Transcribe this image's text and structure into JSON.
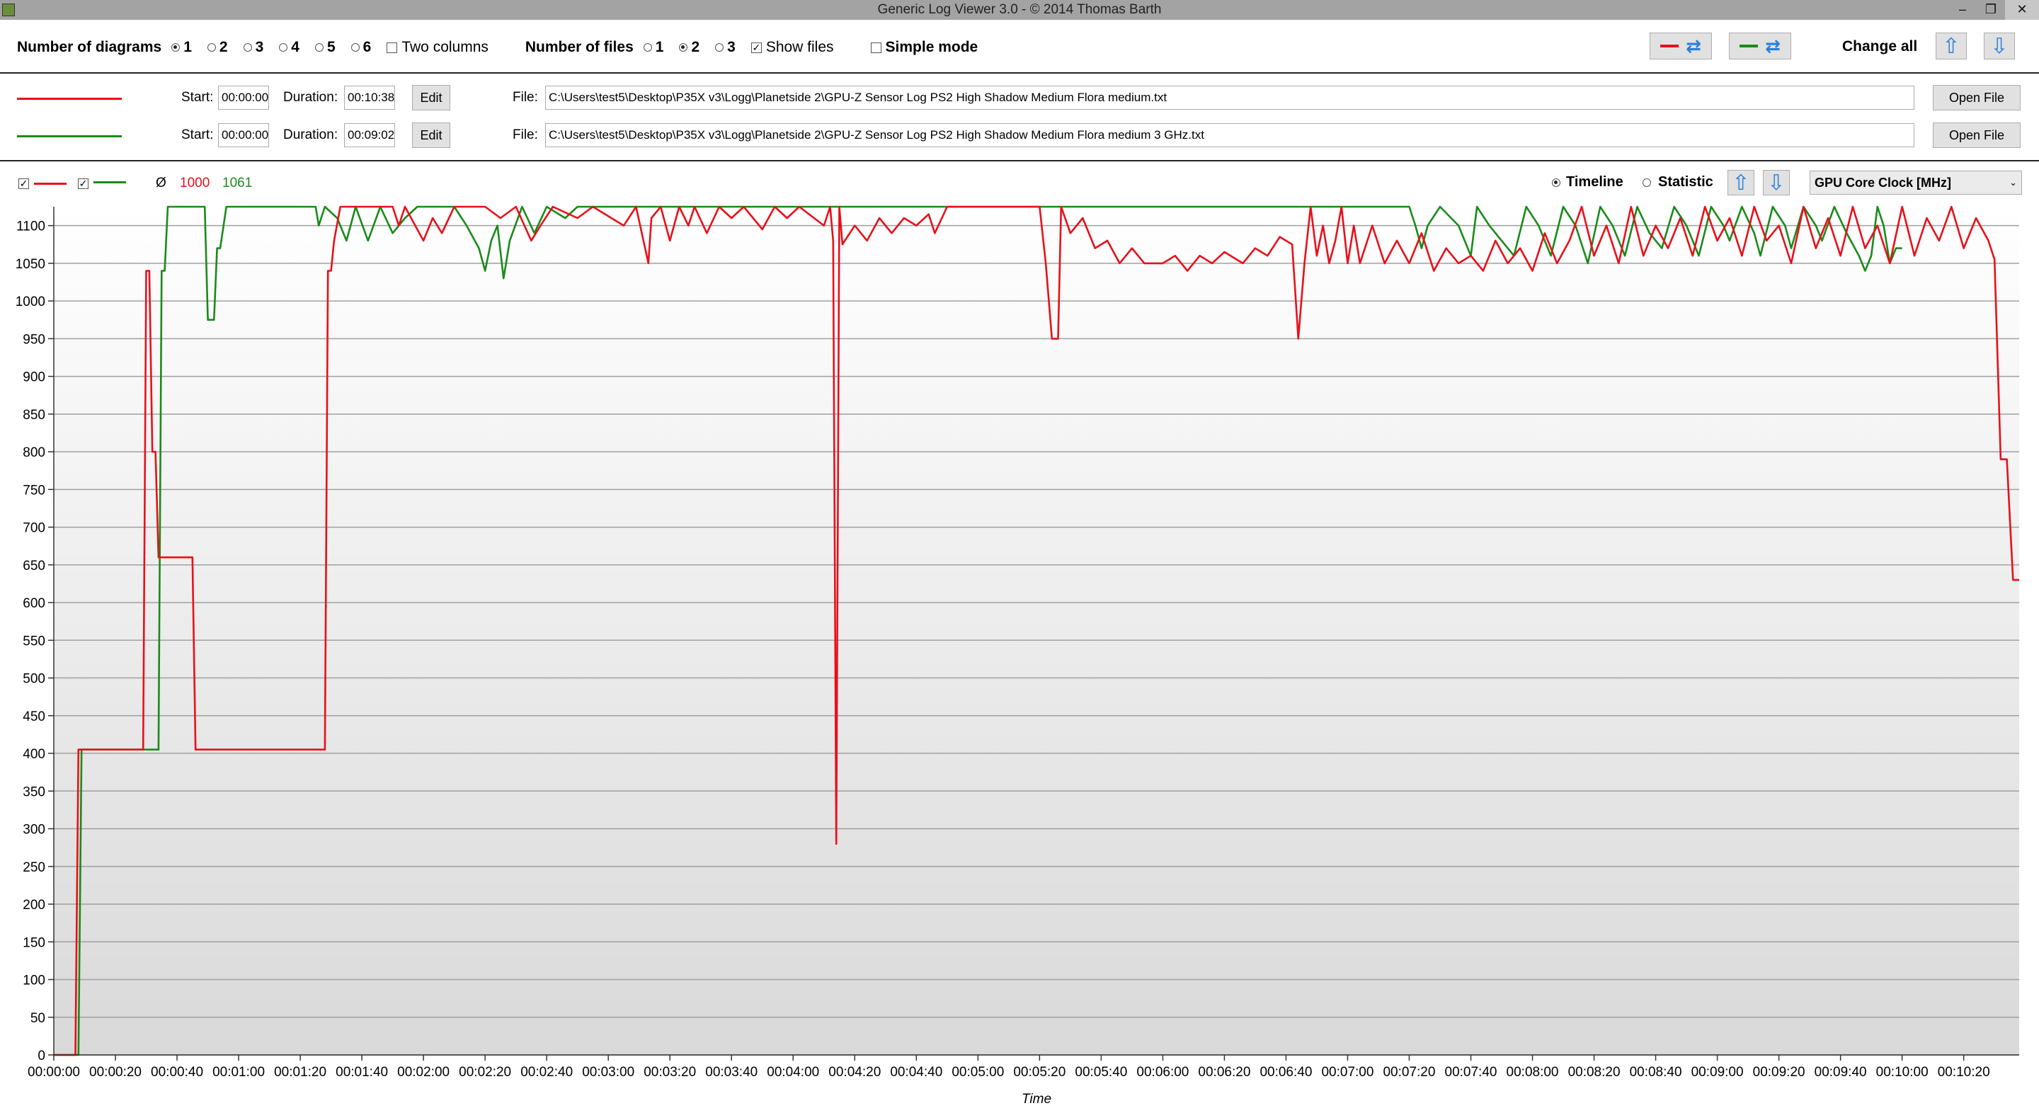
{
  "window": {
    "title": "Generic Log Viewer 3.0 - © 2014 Thomas Barth",
    "min": "‒",
    "max": "❐",
    "close": "✕"
  },
  "toolbar": {
    "diagrams_label": "Number of diagrams",
    "diagram_options": [
      "1",
      "2",
      "3",
      "4",
      "5",
      "6"
    ],
    "diagram_selected": "1",
    "two_columns": "Two columns",
    "files_label": "Number of files",
    "file_options": [
      "1",
      "2",
      "3"
    ],
    "file_selected": "2",
    "show_files": "Show files",
    "simple_mode": "Simple mode",
    "change_all": "Change all"
  },
  "files": [
    {
      "color": "#e8101a",
      "start_label": "Start:",
      "start": "00:00:00",
      "duration_label": "Duration:",
      "duration": "00:10:38",
      "edit": "Edit",
      "file_label": "File:",
      "path": "C:\\Users\\test5\\Desktop\\P35X v3\\Logg\\Planetside 2\\GPU-Z Sensor Log PS2 High Shadow Medium Flora medium.txt",
      "open": "Open File"
    },
    {
      "color": "#1a8a1a",
      "start_label": "Start:",
      "start": "00:00:00",
      "duration_label": "Duration:",
      "duration": "00:09:02",
      "edit": "Edit",
      "file_label": "File:",
      "path": "C:\\Users\\test5\\Desktop\\P35X v3\\Logg\\Planetside 2\\GPU-Z Sensor Log PS2 High Shadow Medium Flora medium 3 GHz.txt",
      "open": "Open File"
    }
  ],
  "chart_bar": {
    "avg_symbol": "Ø",
    "avg1": "1000",
    "avg2": "1061",
    "timeline": "Timeline",
    "statistic": "Statistic",
    "metric": "GPU Core Clock [MHz]"
  },
  "colors": {
    "red": "#e8101a",
    "green": "#1a8a1a",
    "accent": "#2a7fd8"
  },
  "chart_data": {
    "type": "line",
    "xlabel": "Time",
    "ylabel": "",
    "ylim": [
      0,
      1100
    ],
    "xlim_seconds": [
      0,
      638
    ],
    "grid": true,
    "y_ticks": [
      0,
      50,
      100,
      150,
      200,
      250,
      300,
      350,
      400,
      450,
      500,
      550,
      600,
      650,
      700,
      750,
      800,
      850,
      900,
      950,
      1000,
      1050,
      1100
    ],
    "x_ticks": [
      "00:00:00",
      "00:00:20",
      "00:00:40",
      "00:01:00",
      "00:01:20",
      "00:01:40",
      "00:02:00",
      "00:02:20",
      "00:02:40",
      "00:03:00",
      "00:03:20",
      "00:03:40",
      "00:04:00",
      "00:04:20",
      "00:04:40",
      "00:05:00",
      "00:05:20",
      "00:05:40",
      "00:06:00",
      "00:06:20",
      "00:06:40",
      "00:07:00",
      "00:07:20",
      "00:07:40",
      "00:08:00",
      "00:08:20",
      "00:08:40",
      "00:09:00",
      "00:09:20",
      "00:09:40",
      "00:10:00",
      "00:10:20"
    ],
    "series": [
      {
        "color": "#e8101a",
        "points": [
          [
            0,
            0
          ],
          [
            7,
            0
          ],
          [
            8,
            405
          ],
          [
            29,
            405
          ],
          [
            30,
            1040
          ],
          [
            31,
            1040
          ],
          [
            32,
            800
          ],
          [
            33,
            800
          ],
          [
            34,
            660
          ],
          [
            45,
            660
          ],
          [
            46,
            405
          ],
          [
            88,
            405
          ],
          [
            89,
            1040
          ],
          [
            90,
            1040
          ],
          [
            91,
            1080
          ],
          [
            93,
            1125
          ],
          [
            110,
            1125
          ],
          [
            112,
            1100
          ],
          [
            114,
            1125
          ],
          [
            120,
            1080
          ],
          [
            123,
            1110
          ],
          [
            126,
            1090
          ],
          [
            130,
            1125
          ],
          [
            140,
            1125
          ],
          [
            145,
            1110
          ],
          [
            150,
            1125
          ],
          [
            155,
            1080
          ],
          [
            158,
            1100
          ],
          [
            162,
            1125
          ],
          [
            170,
            1110
          ],
          [
            175,
            1125
          ],
          [
            185,
            1100
          ],
          [
            189,
            1125
          ],
          [
            193,
            1050
          ],
          [
            194,
            1110
          ],
          [
            197,
            1125
          ],
          [
            200,
            1080
          ],
          [
            203,
            1125
          ],
          [
            206,
            1100
          ],
          [
            208,
            1125
          ],
          [
            212,
            1090
          ],
          [
            216,
            1125
          ],
          [
            220,
            1110
          ],
          [
            224,
            1125
          ],
          [
            230,
            1095
          ],
          [
            234,
            1125
          ],
          [
            238,
            1110
          ],
          [
            242,
            1125
          ],
          [
            250,
            1100
          ],
          [
            252,
            1125
          ],
          [
            253,
            1080
          ],
          [
            254,
            280
          ],
          [
            255,
            1125
          ],
          [
            256,
            1075
          ],
          [
            260,
            1100
          ],
          [
            264,
            1080
          ],
          [
            268,
            1110
          ],
          [
            272,
            1090
          ],
          [
            276,
            1110
          ],
          [
            280,
            1100
          ],
          [
            284,
            1115
          ],
          [
            286,
            1090
          ],
          [
            290,
            1125
          ],
          [
            320,
            1125
          ],
          [
            322,
            1050
          ],
          [
            324,
            950
          ],
          [
            326,
            950
          ],
          [
            327,
            1125
          ],
          [
            330,
            1090
          ],
          [
            334,
            1110
          ],
          [
            338,
            1070
          ],
          [
            342,
            1080
          ],
          [
            346,
            1050
          ],
          [
            350,
            1070
          ],
          [
            354,
            1050
          ],
          [
            360,
            1050
          ],
          [
            364,
            1060
          ],
          [
            368,
            1040
          ],
          [
            372,
            1060
          ],
          [
            376,
            1050
          ],
          [
            380,
            1065
          ],
          [
            386,
            1050
          ],
          [
            390,
            1070
          ],
          [
            394,
            1060
          ],
          [
            398,
            1085
          ],
          [
            402,
            1075
          ],
          [
            404,
            950
          ],
          [
            406,
            1050
          ],
          [
            408,
            1125
          ],
          [
            410,
            1060
          ],
          [
            412,
            1100
          ],
          [
            414,
            1050
          ],
          [
            416,
            1080
          ],
          [
            418,
            1125
          ],
          [
            420,
            1050
          ],
          [
            422,
            1100
          ],
          [
            424,
            1050
          ],
          [
            428,
            1100
          ],
          [
            432,
            1050
          ],
          [
            436,
            1080
          ],
          [
            440,
            1050
          ],
          [
            444,
            1090
          ],
          [
            448,
            1040
          ],
          [
            452,
            1070
          ],
          [
            456,
            1050
          ],
          [
            460,
            1060
          ],
          [
            464,
            1040
          ],
          [
            468,
            1080
          ],
          [
            472,
            1050
          ],
          [
            476,
            1070
          ],
          [
            480,
            1040
          ],
          [
            484,
            1090
          ],
          [
            488,
            1050
          ],
          [
            492,
            1080
          ],
          [
            496,
            1125
          ],
          [
            500,
            1060
          ],
          [
            504,
            1100
          ],
          [
            508,
            1050
          ],
          [
            512,
            1125
          ],
          [
            516,
            1060
          ],
          [
            520,
            1100
          ],
          [
            524,
            1070
          ],
          [
            528,
            1110
          ],
          [
            532,
            1060
          ],
          [
            536,
            1125
          ],
          [
            540,
            1080
          ],
          [
            544,
            1110
          ],
          [
            548,
            1060
          ],
          [
            552,
            1125
          ],
          [
            556,
            1080
          ],
          [
            560,
            1100
          ],
          [
            564,
            1050
          ],
          [
            568,
            1125
          ],
          [
            572,
            1070
          ],
          [
            576,
            1110
          ],
          [
            580,
            1060
          ],
          [
            584,
            1125
          ],
          [
            588,
            1070
          ],
          [
            592,
            1100
          ],
          [
            596,
            1050
          ],
          [
            600,
            1125
          ],
          [
            604,
            1060
          ],
          [
            608,
            1110
          ],
          [
            612,
            1080
          ],
          [
            616,
            1125
          ],
          [
            620,
            1070
          ],
          [
            624,
            1110
          ],
          [
            628,
            1080
          ],
          [
            630,
            1055
          ],
          [
            632,
            790
          ],
          [
            634,
            790
          ],
          [
            636,
            630
          ],
          [
            638,
            630
          ]
        ]
      },
      {
        "color": "#1a8a1a",
        "points": [
          [
            0,
            0
          ],
          [
            8,
            0
          ],
          [
            9,
            405
          ],
          [
            34,
            405
          ],
          [
            35,
            1040
          ],
          [
            36,
            1040
          ],
          [
            37,
            1125
          ],
          [
            49,
            1125
          ],
          [
            50,
            975
          ],
          [
            52,
            975
          ],
          [
            53,
            1070
          ],
          [
            54,
            1070
          ],
          [
            56,
            1125
          ],
          [
            85,
            1125
          ],
          [
            86,
            1100
          ],
          [
            88,
            1125
          ],
          [
            92,
            1110
          ],
          [
            95,
            1080
          ],
          [
            98,
            1125
          ],
          [
            102,
            1080
          ],
          [
            106,
            1125
          ],
          [
            110,
            1090
          ],
          [
            114,
            1110
          ],
          [
            118,
            1125
          ],
          [
            130,
            1125
          ],
          [
            134,
            1100
          ],
          [
            138,
            1070
          ],
          [
            140,
            1040
          ],
          [
            142,
            1080
          ],
          [
            144,
            1100
          ],
          [
            146,
            1030
          ],
          [
            148,
            1080
          ],
          [
            152,
            1125
          ],
          [
            156,
            1090
          ],
          [
            160,
            1125
          ],
          [
            166,
            1110
          ],
          [
            170,
            1125
          ],
          [
            240,
            1125
          ],
          [
            400,
            1125
          ],
          [
            404,
            1125
          ],
          [
            440,
            1125
          ],
          [
            442,
            1100
          ],
          [
            444,
            1070
          ],
          [
            446,
            1100
          ],
          [
            450,
            1125
          ],
          [
            456,
            1100
          ],
          [
            460,
            1060
          ],
          [
            462,
            1125
          ],
          [
            466,
            1100
          ],
          [
            470,
            1080
          ],
          [
            474,
            1060
          ],
          [
            478,
            1125
          ],
          [
            482,
            1100
          ],
          [
            486,
            1060
          ],
          [
            490,
            1125
          ],
          [
            494,
            1100
          ],
          [
            498,
            1050
          ],
          [
            502,
            1125
          ],
          [
            506,
            1100
          ],
          [
            510,
            1060
          ],
          [
            514,
            1125
          ],
          [
            518,
            1090
          ],
          [
            522,
            1070
          ],
          [
            526,
            1125
          ],
          [
            530,
            1100
          ],
          [
            534,
            1060
          ],
          [
            538,
            1125
          ],
          [
            542,
            1100
          ],
          [
            544,
            1080
          ],
          [
            548,
            1125
          ],
          [
            552,
            1090
          ],
          [
            554,
            1060
          ],
          [
            558,
            1125
          ],
          [
            562,
            1100
          ],
          [
            564,
            1070
          ],
          [
            568,
            1125
          ],
          [
            572,
            1100
          ],
          [
            574,
            1080
          ],
          [
            578,
            1125
          ],
          [
            582,
            1090
          ],
          [
            586,
            1060
          ],
          [
            588,
            1040
          ],
          [
            590,
            1060
          ],
          [
            592,
            1125
          ],
          [
            594,
            1100
          ],
          [
            596,
            1050
          ],
          [
            598,
            1070
          ],
          [
            600,
            1070
          ]
        ]
      }
    ]
  }
}
